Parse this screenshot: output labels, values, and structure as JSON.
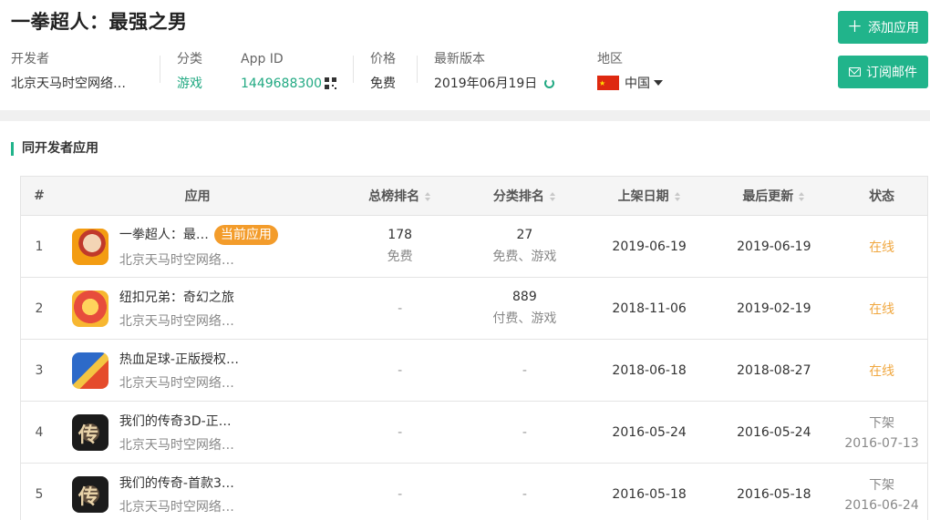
{
  "app": {
    "title": "一拳超人：最强之男",
    "meta": {
      "developer_label": "开发者",
      "developer_value": "北京天马时空网络…",
      "category_label": "分类",
      "category_value": "游戏",
      "appid_label": "App ID",
      "appid_value": "1449688300",
      "price_label": "价格",
      "price_value": "免费",
      "version_label": "最新版本",
      "version_value": "2019年06月19日",
      "region_label": "地区",
      "region_value": "中国"
    },
    "buttons": {
      "add": "添加应用",
      "subscribe": "订阅邮件"
    }
  },
  "section_title": "同开发者应用",
  "table": {
    "headers": {
      "num": "#",
      "app": "应用",
      "rank": "总榜排名",
      "cat": "分类排名",
      "release": "上架日期",
      "update": "最后更新",
      "status": "状态"
    },
    "rows": [
      {
        "num": "1",
        "name": "一拳超人：最…",
        "badge": "当前应用",
        "dev": "北京天马时空网络…",
        "rank": "178",
        "rank_sub": "免费",
        "cat": "27",
        "cat_sub": "免费、游戏",
        "release": "2019-06-19",
        "update": "2019-06-19",
        "status": "在线",
        "status_sub": ""
      },
      {
        "num": "2",
        "name": "纽扣兄弟：奇幻之旅",
        "badge": "",
        "dev": "北京天马时空网络…",
        "rank": "-",
        "rank_sub": "",
        "cat": "889",
        "cat_sub": "付费、游戏",
        "release": "2018-11-06",
        "update": "2019-02-19",
        "status": "在线",
        "status_sub": ""
      },
      {
        "num": "3",
        "name": "热血足球-正版授权…",
        "badge": "",
        "dev": "北京天马时空网络…",
        "rank": "-",
        "rank_sub": "",
        "cat": "-",
        "cat_sub": "",
        "release": "2018-06-18",
        "update": "2018-08-27",
        "status": "在线",
        "status_sub": ""
      },
      {
        "num": "4",
        "name": "我们的传奇3D-正…",
        "badge": "",
        "dev": "北京天马时空网络…",
        "rank": "-",
        "rank_sub": "",
        "cat": "-",
        "cat_sub": "",
        "release": "2016-05-24",
        "update": "2016-05-24",
        "status": "下架",
        "status_sub": "2016-07-13"
      },
      {
        "num": "5",
        "name": "我们的传奇-首款3…",
        "badge": "",
        "dev": "北京天马时空网络…",
        "rank": "-",
        "rank_sub": "",
        "cat": "-",
        "cat_sub": "",
        "release": "2016-05-18",
        "update": "2016-05-18",
        "status": "下架",
        "status_sub": "2016-06-24"
      }
    ]
  },
  "colors": {
    "accent": "#21b48b",
    "online": "#f0a73f",
    "badge": "#f39c2b"
  }
}
